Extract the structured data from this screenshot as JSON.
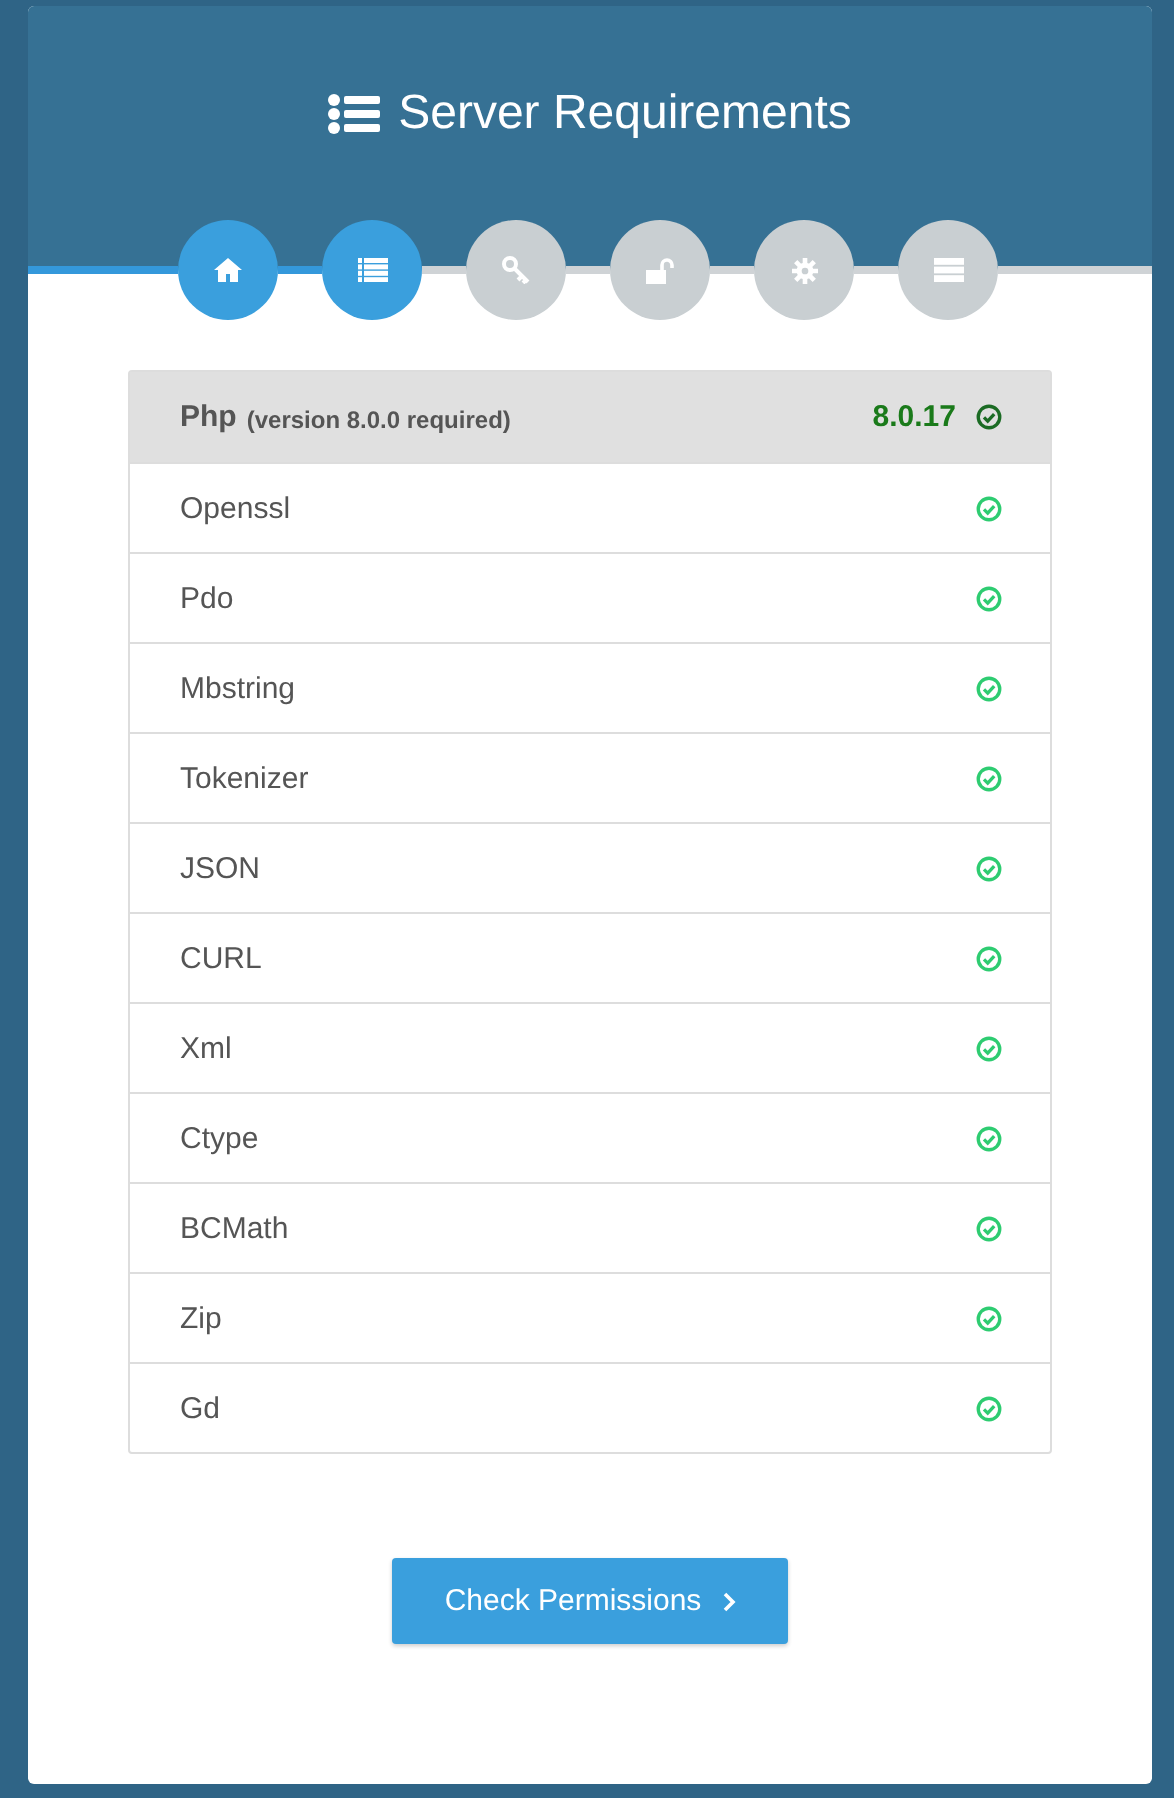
{
  "header": {
    "title": "Server Requirements"
  },
  "steps": [
    {
      "kind": "home",
      "done": true
    },
    {
      "kind": "list",
      "done": true
    },
    {
      "kind": "key",
      "done": false
    },
    {
      "kind": "unlock",
      "done": false
    },
    {
      "kind": "gear",
      "done": false
    },
    {
      "kind": "server",
      "done": false
    }
  ],
  "php": {
    "name": "Php",
    "requirement": "(version 8.0.0 required)",
    "version": "8.0.17",
    "ok": true
  },
  "requirements": [
    {
      "name": "Openssl",
      "ok": true
    },
    {
      "name": "Pdo",
      "ok": true
    },
    {
      "name": "Mbstring",
      "ok": true
    },
    {
      "name": "Tokenizer",
      "ok": true
    },
    {
      "name": "JSON",
      "ok": true
    },
    {
      "name": "CURL",
      "ok": true
    },
    {
      "name": "Xml",
      "ok": true
    },
    {
      "name": "Ctype",
      "ok": true
    },
    {
      "name": "BCMath",
      "ok": true
    },
    {
      "name": "Zip",
      "ok": true
    },
    {
      "name": "Gd",
      "ok": true
    }
  ],
  "button": {
    "label": "Check Permissions"
  }
}
